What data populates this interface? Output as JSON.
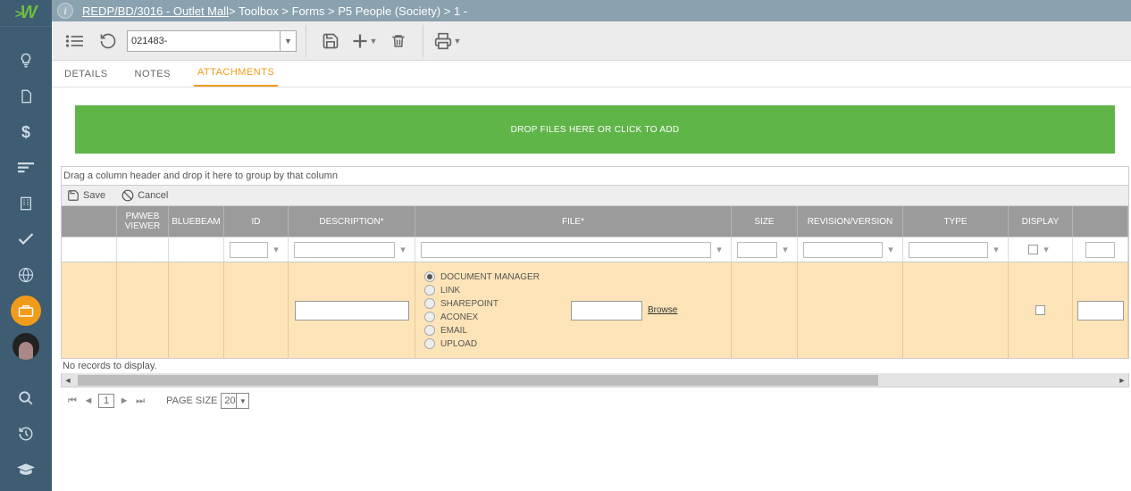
{
  "breadcrumb": {
    "link_text": "REDP/BD/3016 - Outlet Mall",
    "rest": " > Toolbox > Forms > P5 People (Society) > 1 -  "
  },
  "toolbar": {
    "record_value": "021483-"
  },
  "tabs": [
    {
      "label": "DETAILS",
      "active": false
    },
    {
      "label": "NOTES",
      "active": false
    },
    {
      "label": "ATTACHMENTS",
      "active": true
    }
  ],
  "dropzone": {
    "text": "DROP FILES HERE OR CLICK TO ADD"
  },
  "grid": {
    "group_hint": "Drag a column header and drop it here to group by that column",
    "save_label": "Save",
    "cancel_label": "Cancel",
    "columns": {
      "pmweb": "PMWEB VIEWER",
      "bluebeam": "BLUEBEAM",
      "id": "ID",
      "description": "DESCRIPTION*",
      "file": "FILE*",
      "size": "SIZE",
      "revision": "REVISION/VERSION",
      "type": "TYPE",
      "display": "DISPLAY"
    },
    "no_records": "No records to display.",
    "file_options": [
      {
        "label": "DOCUMENT MANAGER",
        "checked": true
      },
      {
        "label": "LINK",
        "checked": false
      },
      {
        "label": "SHAREPOINT",
        "checked": false
      },
      {
        "label": "ACONEX",
        "checked": false
      },
      {
        "label": "EMAIL",
        "checked": false
      },
      {
        "label": "UPLOAD",
        "checked": false
      }
    ],
    "browse_label": "Browse"
  },
  "pager": {
    "page": "1",
    "page_size_label": "PAGE SIZE",
    "page_size": "20"
  }
}
